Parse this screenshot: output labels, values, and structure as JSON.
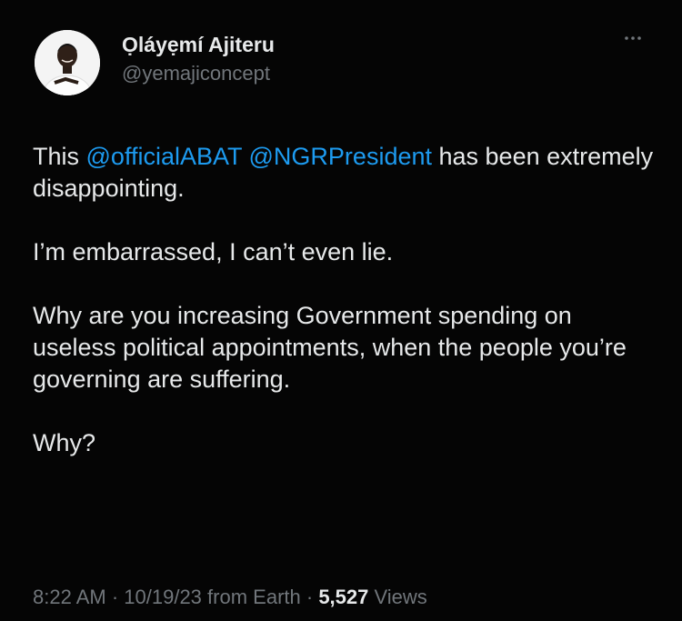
{
  "author": {
    "display_name": "Ọláyẹmí Ajiteru",
    "handle": "@yemajiconcept"
  },
  "tweet": {
    "line1_prefix": "This ",
    "mention1": "@officialABAT",
    "mention2": "@NGRPresident",
    "line1_suffix": " has been extremely disappointing.",
    "paragraph2": "I’m embarrassed, I can’t even lie.",
    "paragraph3": "Why are you increasing Government spending on useless political appointments, when the people you’re governing are suffering.",
    "paragraph4": "Why?"
  },
  "meta": {
    "time": "8:22 AM",
    "date": "10/19/23",
    "source": "from Earth",
    "separator": " · ",
    "views_count": "5,527",
    "views_label": "Views"
  },
  "icons": {
    "more": "more-horizontal-icon",
    "avatar": "profile-photo"
  },
  "colors": {
    "background": "#050505",
    "text": "#e7e9ea",
    "secondary": "#71767b",
    "link": "#1d9bf0"
  }
}
